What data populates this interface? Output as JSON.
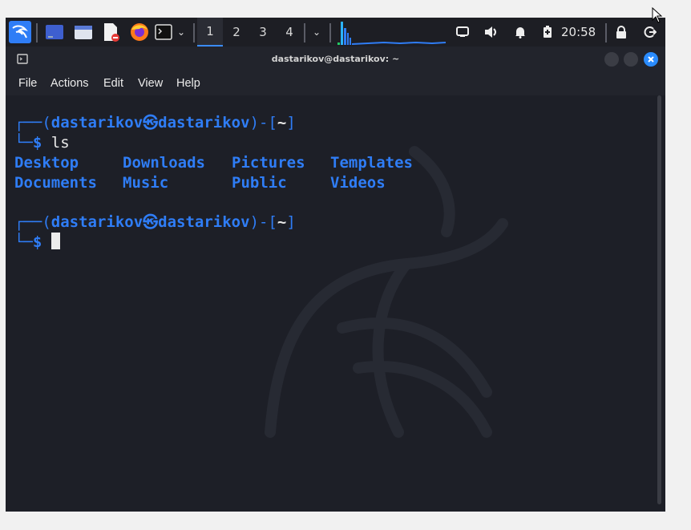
{
  "panel": {
    "workspaces": [
      "1",
      "2",
      "3",
      "4"
    ],
    "active_workspace": "1",
    "clock": "20:58",
    "launchers": [
      "kali-menu-icon",
      "desktop-icon",
      "file-manager-icon",
      "text-editor-icon",
      "firefox-icon",
      "terminal-icon"
    ],
    "tray": [
      "display-icon",
      "volume-icon",
      "notification-bell-icon",
      "battery-icon",
      "lock-icon",
      "logout-icon"
    ]
  },
  "terminal": {
    "title": "dastarikov@dastarikov: ~",
    "menu": [
      "File",
      "Actions",
      "Edit",
      "View",
      "Help"
    ],
    "prompt1": {
      "user": "dastarikov",
      "at": "㉿",
      "host": "dastarikov",
      "dir": "~",
      "command": "ls"
    },
    "ls_output": {
      "row1": [
        "Desktop",
        "Downloads",
        "Pictures",
        "Templates"
      ],
      "row2": [
        "Documents",
        "Music",
        "Public",
        "Videos"
      ]
    },
    "prompt2": {
      "user": "dastarikov",
      "at": "㉿",
      "host": "dastarikov",
      "dir": "~"
    },
    "prompt_symbol": "$",
    "colors": {
      "accent": "#2f7df6",
      "background": "#1d1f27",
      "close_button": "#2a8cff"
    }
  }
}
